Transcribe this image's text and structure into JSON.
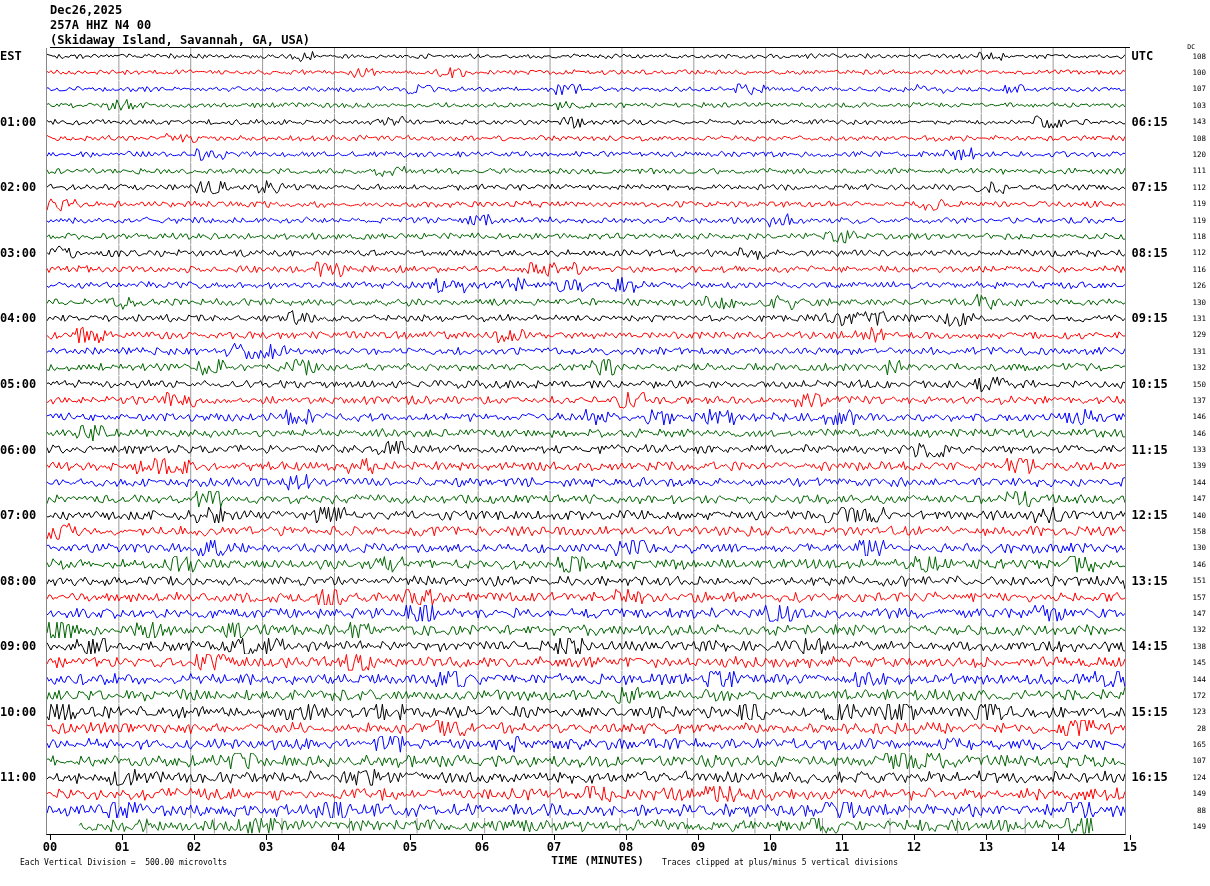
{
  "header": {
    "date": "Dec26,2025",
    "station": "257A HHZ N4 00",
    "location": "(Skidaway Island, Savannah, GA, USA)"
  },
  "left_axis_title": "EST",
  "right_axis_title": "UTC",
  "dc_title": "DC",
  "traces": [
    {
      "dc": "108",
      "color": "#000000"
    },
    {
      "dc": "100",
      "color": "#ff0000"
    },
    {
      "dc": "107",
      "color": "#0000ff"
    },
    {
      "dc": "103",
      "color": "#006400"
    },
    {
      "est": "01:00",
      "utc": "06:15",
      "dc": "143",
      "color": "#000000"
    },
    {
      "dc": "108",
      "color": "#ff0000"
    },
    {
      "dc": "120",
      "color": "#0000ff"
    },
    {
      "dc": "111",
      "color": "#006400"
    },
    {
      "est": "02:00",
      "utc": "07:15",
      "dc": "112",
      "color": "#000000"
    },
    {
      "dc": "119",
      "color": "#ff0000"
    },
    {
      "dc": "119",
      "color": "#0000ff"
    },
    {
      "dc": "118",
      "color": "#006400"
    },
    {
      "est": "03:00",
      "utc": "08:15",
      "dc": "112",
      "color": "#000000"
    },
    {
      "dc": "116",
      "color": "#ff0000"
    },
    {
      "dc": "126",
      "color": "#0000ff"
    },
    {
      "dc": "130",
      "color": "#006400"
    },
    {
      "est": "04:00",
      "utc": "09:15",
      "dc": "131",
      "color": "#000000"
    },
    {
      "dc": "129",
      "color": "#ff0000"
    },
    {
      "dc": "131",
      "color": "#0000ff"
    },
    {
      "dc": "132",
      "color": "#006400"
    },
    {
      "est": "05:00",
      "utc": "10:15",
      "dc": "150",
      "color": "#000000"
    },
    {
      "dc": "137",
      "color": "#ff0000"
    },
    {
      "dc": "146",
      "color": "#0000ff"
    },
    {
      "dc": "146",
      "color": "#006400"
    },
    {
      "est": "06:00",
      "utc": "11:15",
      "dc": "133",
      "color": "#000000"
    },
    {
      "dc": "139",
      "color": "#ff0000"
    },
    {
      "dc": "144",
      "color": "#0000ff"
    },
    {
      "dc": "147",
      "color": "#006400"
    },
    {
      "est": "07:00",
      "utc": "12:15",
      "dc": "140",
      "color": "#000000"
    },
    {
      "dc": "158",
      "color": "#ff0000"
    },
    {
      "dc": "130",
      "color": "#0000ff"
    },
    {
      "dc": "146",
      "color": "#006400"
    },
    {
      "est": "08:00",
      "utc": "13:15",
      "dc": "151",
      "color": "#000000"
    },
    {
      "dc": "157",
      "color": "#ff0000"
    },
    {
      "dc": "147",
      "color": "#0000ff"
    },
    {
      "dc": "132",
      "color": "#006400"
    },
    {
      "est": "09:00",
      "utc": "14:15",
      "dc": "138",
      "color": "#000000"
    },
    {
      "dc": "145",
      "color": "#ff0000"
    },
    {
      "dc": "144",
      "color": "#0000ff"
    },
    {
      "dc": "172",
      "color": "#006400"
    },
    {
      "est": "10:00",
      "utc": "15:15",
      "dc": "123",
      "color": "#000000"
    },
    {
      "dc": "28",
      "color": "#ff0000"
    },
    {
      "dc": "165",
      "color": "#0000ff"
    },
    {
      "dc": "107",
      "color": "#006400"
    },
    {
      "est": "11:00",
      "utc": "16:15",
      "dc": "124",
      "color": "#000000"
    },
    {
      "dc": "149",
      "color": "#ff0000"
    },
    {
      "dc": "88",
      "color": "#0000ff"
    },
    {
      "dc": "149",
      "color": "#006400"
    }
  ],
  "x_ticks": [
    "00",
    "01",
    "02",
    "03",
    "04",
    "05",
    "06",
    "07",
    "08",
    "09",
    "10",
    "11",
    "12",
    "13",
    "14",
    "15"
  ],
  "footer": {
    "scale_note": "Each Vertical Division =  500.00 microvolts",
    "xlabel": "TIME (MINUTES)",
    "clip_note": "Traces clipped at plus/minus 5 vertical divisions"
  }
}
